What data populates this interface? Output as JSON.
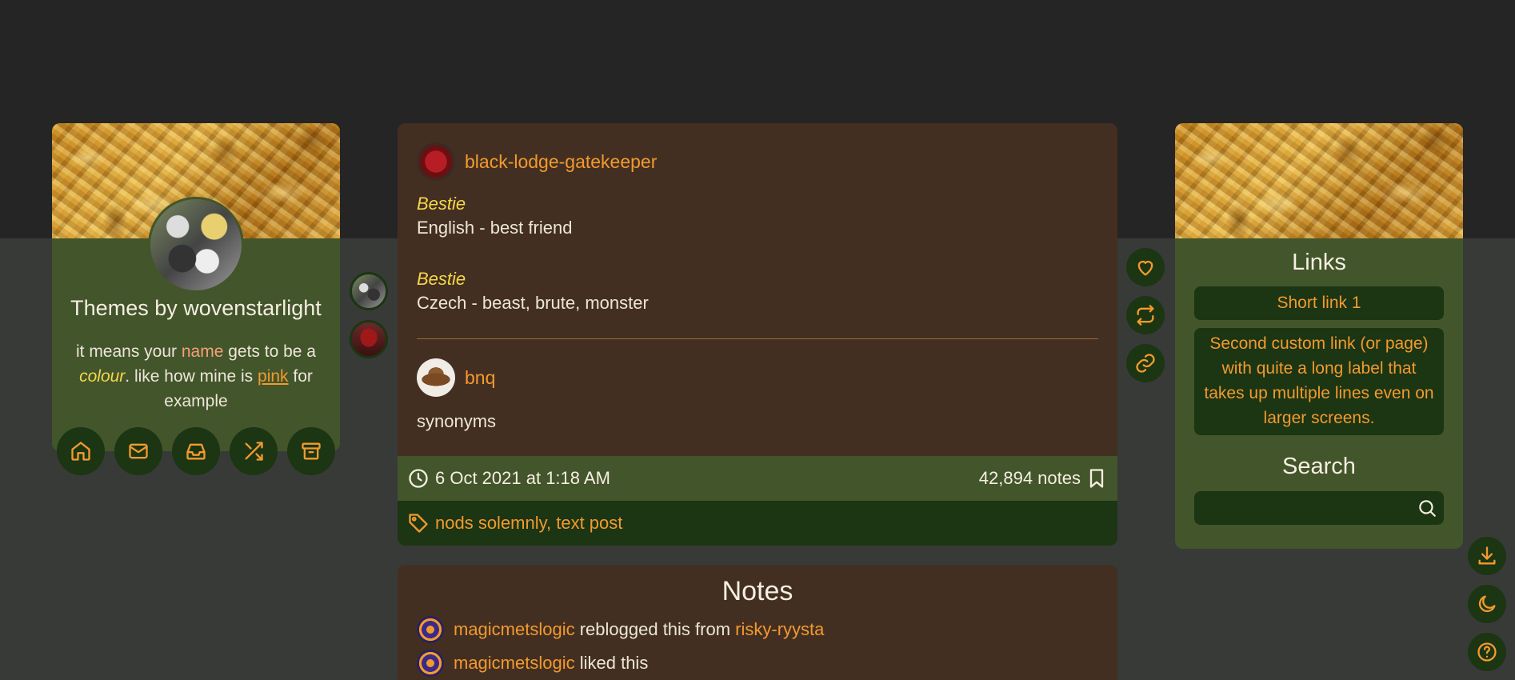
{
  "sidebar": {
    "blog_title": "Themes by wovenstarlight",
    "description": {
      "part1": "it means your ",
      "name": "name",
      "part2": " gets to be a ",
      "colour": "colour",
      "part3": ". like how mine is ",
      "pink": "pink",
      "part4": " for example"
    },
    "nav_icons": [
      "home-icon",
      "mail-icon",
      "inbox-icon",
      "shuffle-icon",
      "archive-icon"
    ]
  },
  "post": {
    "users": [
      {
        "name": "black-lodge-gatekeeper"
      },
      {
        "name": "bnq"
      }
    ],
    "entries": [
      {
        "word": "Bestie",
        "meaning": "English - best friend"
      },
      {
        "word": "Bestie",
        "meaning": "Czech - beast, brute, monster"
      }
    ],
    "reply": "synonyms",
    "date": "6 Oct 2021 at 1:18 AM",
    "notes_count": "42,894 notes",
    "tags": "nods solemnly, text post"
  },
  "post_actions": [
    "heart-icon",
    "reblog-icon",
    "link-icon"
  ],
  "notes": {
    "title": "Notes",
    "items": [
      {
        "user": "magicmetslogic",
        "action": " reblogged this from ",
        "source": "risky-ryysta"
      },
      {
        "user": "magicmetslogic",
        "action": " liked this",
        "source": ""
      }
    ]
  },
  "right_sidebar": {
    "links_title": "Links",
    "links": [
      "Short link 1",
      "Second custom link (or page) with quite a long label that takes up multiple lines even on larger screens."
    ],
    "search_title": "Search",
    "search_placeholder": ""
  },
  "floating_buttons": [
    "download-icon",
    "moon-icon",
    "help-icon"
  ],
  "colors": {
    "accent": "#f29a2e",
    "green_card": "#43552b",
    "dark_green": "#1c3512",
    "post_brown": "#432f22"
  }
}
